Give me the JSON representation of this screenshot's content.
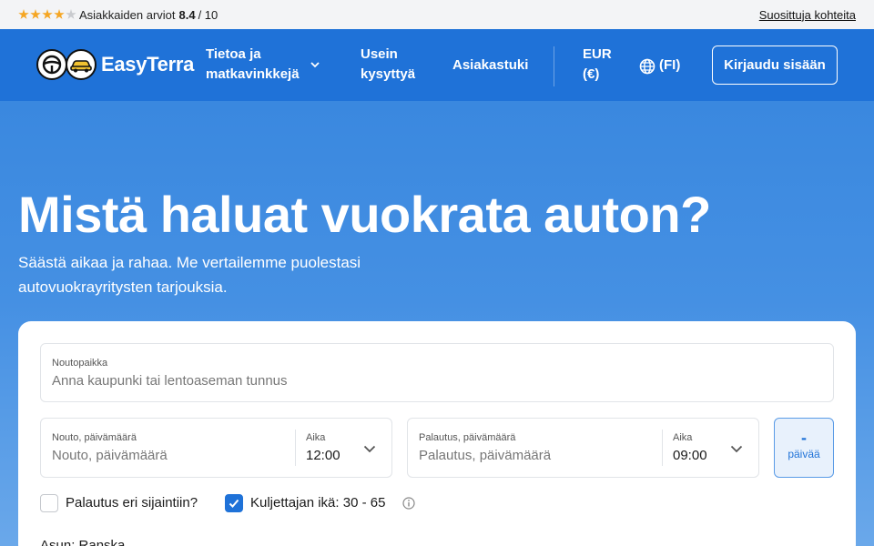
{
  "topbar": {
    "rating": {
      "stars_filled": 4,
      "stars_total": 5,
      "label": "Asiakkaiden arviot",
      "score": "8.4",
      "max": "/ 10"
    },
    "popular_link": "Suosittuja kohteita"
  },
  "nav": {
    "logo_text": "EasyTerra",
    "about_line1": "Tietoa ja",
    "about_line2": "matkavinkkejä",
    "faq_line1": "Usein",
    "faq_line2": "kysyttyä",
    "support": "Asiakastuki",
    "currency_line1": "EUR",
    "currency_line2": "(€)",
    "language": "(FI)",
    "login": "Kirjaudu sisään"
  },
  "hero": {
    "title": "Mistä haluat vuokrata auton?",
    "subtitle": "Säästä aikaa ja rahaa. Me vertailemme puolestasi autovuokrayritysten tarjouksia."
  },
  "search": {
    "pickup_location": {
      "label": "Noutopaikka",
      "placeholder": "Anna kaupunki tai lentoaseman tunnus"
    },
    "pickup_date": {
      "label": "Nouto, päivämäärä",
      "placeholder": "Nouto, päivämäärä",
      "time_label": "Aika",
      "time": "12:00"
    },
    "return_date": {
      "label": "Palautus, päivämäärä",
      "placeholder": "Palautus, päivämäärä",
      "time_label": "Aika",
      "time": "09:00"
    },
    "days": {
      "value": "-",
      "label": "päivää"
    },
    "different_return": {
      "label": "Palautus eri sijaintiin?",
      "checked": false
    },
    "driver_age": {
      "label": "Kuljettajan ikä: 30 - 65",
      "checked": true
    },
    "residence": "Asun: Ranska"
  },
  "colors": {
    "brand": "#1f72d8",
    "star": "#f5a623"
  }
}
